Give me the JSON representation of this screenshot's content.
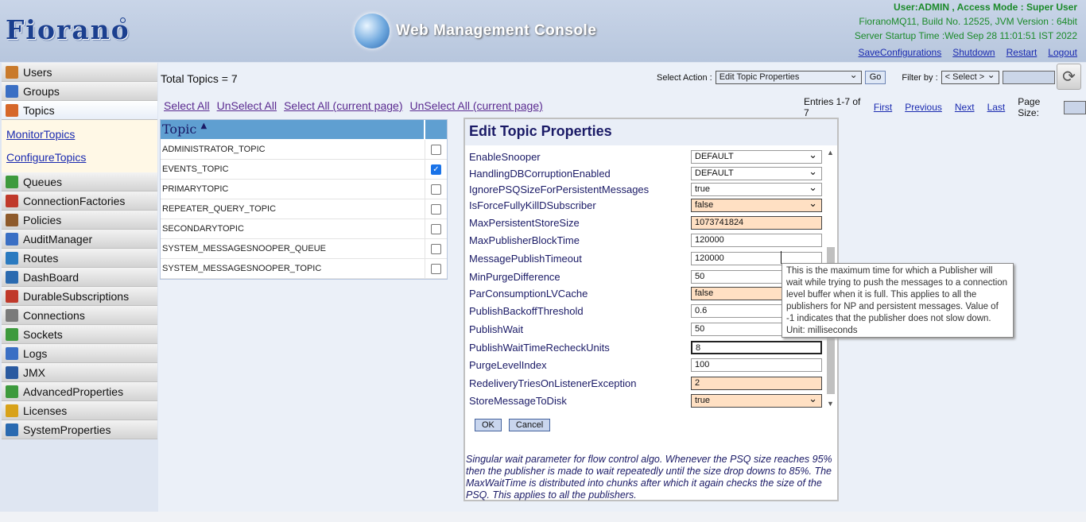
{
  "header": {
    "logo": "Fiorano",
    "console_title": "Web Management Console",
    "user": "User:ADMIN , Access Mode : Super User",
    "build": "FioranoMQ11, Build No. 12525, JVM Version : 64bit",
    "startup": "Server Startup Time :Wed Sep 28 11:01:51 IST 2022",
    "links": [
      "SaveConfigurations",
      "Shutdown",
      "Restart",
      "Logout"
    ]
  },
  "sidebar": {
    "items": [
      {
        "label": "Users",
        "icon": "users-icon",
        "color": "#c97a2b"
      },
      {
        "label": "Groups",
        "icon": "groups-icon",
        "color": "#3a6fc4"
      },
      {
        "label": "Topics",
        "icon": "topics-icon",
        "color": "#d6672a"
      },
      {
        "label": "Queues",
        "icon": "queues-icon",
        "color": "#3d9a3d"
      },
      {
        "label": "ConnectionFactories",
        "icon": "connection-factories-icon",
        "color": "#c0392b"
      },
      {
        "label": "Policies",
        "icon": "policies-icon",
        "color": "#8e5a2b"
      },
      {
        "label": "AuditManager",
        "icon": "audit-manager-icon",
        "color": "#3a6fc4"
      },
      {
        "label": "Routes",
        "icon": "routes-icon",
        "color": "#2a7ac0"
      },
      {
        "label": "DashBoard",
        "icon": "dashboard-icon",
        "color": "#2a6ab0"
      },
      {
        "label": "DurableSubscriptions",
        "icon": "durable-subscriptions-icon",
        "color": "#c0392b"
      },
      {
        "label": "Connections",
        "icon": "connections-icon",
        "color": "#7a7a7a"
      },
      {
        "label": "Sockets",
        "icon": "sockets-icon",
        "color": "#3d9a3d"
      },
      {
        "label": "Logs",
        "icon": "logs-icon",
        "color": "#3a6fc4"
      },
      {
        "label": "JMX",
        "icon": "jmx-icon",
        "color": "#2a5aa0"
      },
      {
        "label": "AdvancedProperties",
        "icon": "advanced-properties-icon",
        "color": "#3d9a3d"
      },
      {
        "label": "Licenses",
        "icon": "licenses-icon",
        "color": "#d8a21a"
      },
      {
        "label": "SystemProperties",
        "icon": "system-properties-icon",
        "color": "#2a6ab0"
      }
    ],
    "subitems": [
      "MonitorTopics",
      "ConfigureTopics"
    ]
  },
  "main": {
    "total": "Total Topics = 7",
    "select_action_label": "Select Action :",
    "action_value": "Edit Topic Properties",
    "go": "Go",
    "filter_label": "Filter by :",
    "filter_value": "< Select >",
    "select_links": [
      "Select All",
      "UnSelect All",
      "Select All (current page)",
      "UnSelect All (current page)"
    ],
    "paging": {
      "entries": "Entries 1-7 of 7",
      "first": "First",
      "previous": "Previous",
      "next": "Next",
      "last": "Last",
      "page_size": "Page Size:"
    },
    "topic_header": "Topic",
    "topics": [
      {
        "name": "ADMINISTRATOR_TOPIC",
        "checked": false
      },
      {
        "name": "EVENTS_TOPIC",
        "checked": true
      },
      {
        "name": "PRIMARYTOPIC",
        "checked": false
      },
      {
        "name": "REPEATER_QUERY_TOPIC",
        "checked": false
      },
      {
        "name": "SECONDARYTOPIC",
        "checked": false
      },
      {
        "name": "SYSTEM_MESSAGESNOOPER_QUEUE",
        "checked": false
      },
      {
        "name": "SYSTEM_MESSAGESNOOPER_TOPIC",
        "checked": false
      }
    ]
  },
  "panel": {
    "title": "Edit Topic Properties",
    "props": [
      {
        "name": "EnableSnooper",
        "value": "DEFAULT",
        "kind": "select",
        "style": ""
      },
      {
        "name": "HandlingDBCorruptionEnabled",
        "value": "DEFAULT",
        "kind": "select",
        "style": ""
      },
      {
        "name": "IgnorePSQSizeForPersistentMessages",
        "value": "true",
        "kind": "select",
        "style": ""
      },
      {
        "name": "IsForceFullyKillDSubscriber",
        "value": "false",
        "kind": "select",
        "style": "orange"
      },
      {
        "name": "MaxPersistentStoreSize",
        "value": "1073741824",
        "kind": "input",
        "style": "orange"
      },
      {
        "name": "MaxPublisherBlockTime",
        "value": "120000",
        "kind": "input",
        "style": ""
      },
      {
        "name": "MessagePublishTimeout",
        "value": "120000",
        "kind": "input",
        "style": ""
      },
      {
        "name": "MinPurgeDifference",
        "value": "50",
        "kind": "input",
        "style": ""
      },
      {
        "name": "ParConsumptionLVCache",
        "value": "false",
        "kind": "select",
        "style": "orange"
      },
      {
        "name": "PublishBackoffThreshold",
        "value": "0.6",
        "kind": "input",
        "style": ""
      },
      {
        "name": "PublishWait",
        "value": "50",
        "kind": "input",
        "style": ""
      },
      {
        "name": "PublishWaitTimeRecheckUnits",
        "value": "8",
        "kind": "input",
        "style": "dark"
      },
      {
        "name": "PurgeLevelIndex",
        "value": "100",
        "kind": "input",
        "style": ""
      },
      {
        "name": "RedeliveryTriesOnListenerException",
        "value": "2",
        "kind": "input",
        "style": "orange"
      },
      {
        "name": "StoreMessageToDisk",
        "value": "true",
        "kind": "select",
        "style": "orange"
      }
    ],
    "ok": "OK",
    "cancel": "Cancel",
    "description": "Singular wait parameter for flow control algo. Whenever the PSQ size reaches 95% then the publisher is made to wait repeatedly until the size drop downs to 85%. The MaxWaitTime is distributed into chunks after which it again checks the size of the PSQ. This applies to all the publishers."
  },
  "tooltip": "This is the maximum time for which a Publisher will wait while trying to push the messages to a connection level buffer when it is full. This applies to all the publishers for NP and persistent messages. Value of -1 indicates that the publisher does not slow down. Unit: milliseconds"
}
